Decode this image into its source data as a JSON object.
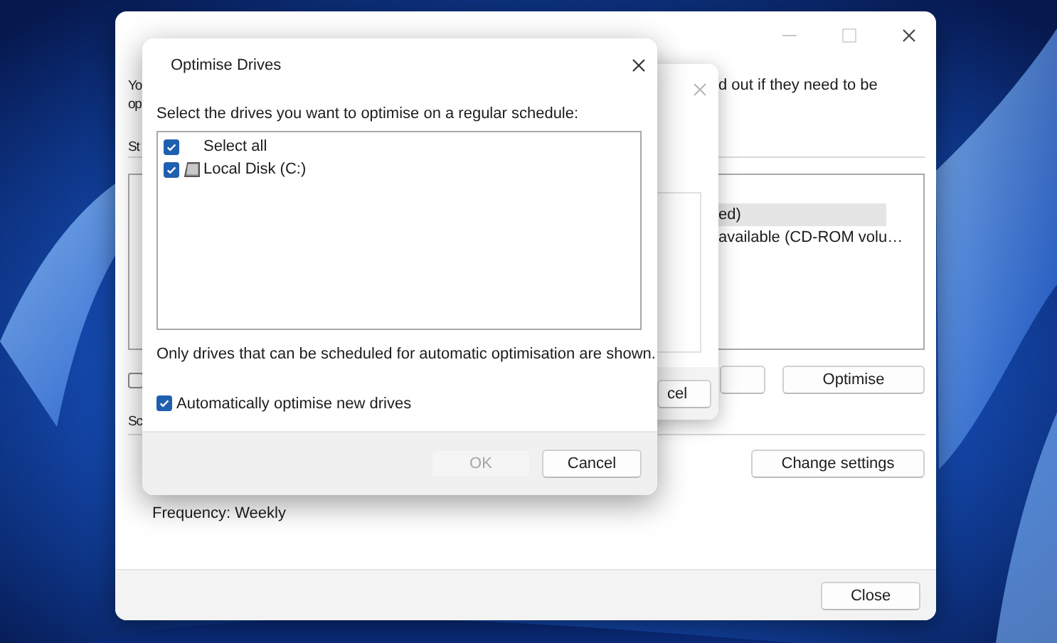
{
  "main_window": {
    "intro_lines": [
      "Yo",
      "op"
    ],
    "intro_right": "d out if they need to be",
    "status_label": "St",
    "drive_rows": [
      {
        "text": "ed)",
        "selected": true
      },
      {
        "text": "available (CD-ROM volu…",
        "selected": false
      }
    ],
    "left_checkbox": {
      "checked": false
    },
    "optimise_button": "Optimise",
    "scheduled_label": "Sc",
    "change_settings_button": "Change settings",
    "frequency": "Frequency: Weekly",
    "close_button": "Close"
  },
  "middle_dialog": {
    "cancel_button": "cel"
  },
  "front_dialog": {
    "title": "Optimise Drives",
    "prompt": "Select the drives you want to optimise on a regular schedule:",
    "items": [
      {
        "label": "Select all",
        "kind": "select-all",
        "checked": true
      },
      {
        "label": "Local Disk  (C:)",
        "kind": "drive",
        "checked": true
      }
    ],
    "note": "Only drives that can be scheduled for automatic optimisation are shown.",
    "auto_optimise": {
      "label": "Automatically optimise new drives",
      "checked": true
    },
    "ok_button": {
      "label": "OK",
      "disabled": true
    },
    "cancel_button": {
      "label": "Cancel",
      "disabled": false
    }
  }
}
